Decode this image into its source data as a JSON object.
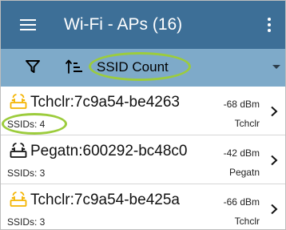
{
  "app_bar": {
    "title": "Wi-Fi - APs (16)",
    "menu_icon": "hamburger-menu-icon",
    "more_icon": "more-vertical-icon",
    "background_color": "#3d6f97"
  },
  "toolbar": {
    "filter_icon": "filter-funnel-icon",
    "sort_icon": "sort-order-icon",
    "sort_label": "SSID Count",
    "dropdown_icon": "dropdown-triangle-icon",
    "background_color": "#7eaac9",
    "highlight_color": "#9ccc3c"
  },
  "access_points": [
    {
      "name": "Tchclr:7c9a54-be4263",
      "ssids": "SSIDs: 4",
      "signal": "-68 dBm",
      "vendor": "Tchclr",
      "icon": "access-point-icon",
      "icon_color": "#f4b400"
    },
    {
      "name": "Pegatn:600292-bc48c0",
      "ssids": "SSIDs: 3",
      "signal": "-42 dBm",
      "vendor": "Pegatn",
      "icon": "access-point-icon",
      "icon_color": "#111111"
    },
    {
      "name": "Tchclr:7c9a54-be425a",
      "ssids": "SSIDs: 3",
      "signal": "-66 dBm",
      "vendor": "Tchclr",
      "icon": "access-point-icon",
      "icon_color": "#f4b400"
    }
  ]
}
